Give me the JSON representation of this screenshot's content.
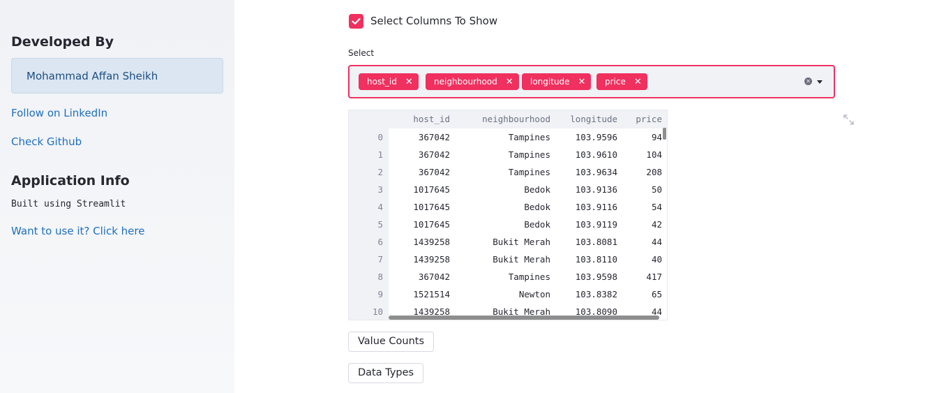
{
  "sidebar": {
    "developed_heading": "Developed By",
    "developer_name": "Mohammad Affan Sheikh",
    "linkedin_link": "Follow on LinkedIn",
    "github_link": "Check Github",
    "app_info_heading": "Application Info",
    "built_using": "Built using Streamlit",
    "use_link": "Want to use it? Click here"
  },
  "main": {
    "checkbox_label": "Select Columns To Show",
    "checkbox_checked": true,
    "select_label": "Select",
    "selected_chips": [
      "host_id",
      "neighbourhood",
      "longitude",
      "price"
    ],
    "buttons": {
      "value_counts": "Value Counts",
      "data_types": "Data Types"
    }
  },
  "table": {
    "columns": [
      "host_id",
      "neighbourhood",
      "longitude",
      "price"
    ],
    "rows": [
      {
        "index": "0",
        "host_id": "367042",
        "neighbourhood": "Tampines",
        "longitude": "103.9596",
        "price": "94"
      },
      {
        "index": "1",
        "host_id": "367042",
        "neighbourhood": "Tampines",
        "longitude": "103.9610",
        "price": "104"
      },
      {
        "index": "2",
        "host_id": "367042",
        "neighbourhood": "Tampines",
        "longitude": "103.9634",
        "price": "208"
      },
      {
        "index": "3",
        "host_id": "1017645",
        "neighbourhood": "Bedok",
        "longitude": "103.9136",
        "price": "50"
      },
      {
        "index": "4",
        "host_id": "1017645",
        "neighbourhood": "Bedok",
        "longitude": "103.9116",
        "price": "54"
      },
      {
        "index": "5",
        "host_id": "1017645",
        "neighbourhood": "Bedok",
        "longitude": "103.9119",
        "price": "42"
      },
      {
        "index": "6",
        "host_id": "1439258",
        "neighbourhood": "Bukit Merah",
        "longitude": "103.8081",
        "price": "44"
      },
      {
        "index": "7",
        "host_id": "1439258",
        "neighbourhood": "Bukit Merah",
        "longitude": "103.8110",
        "price": "40"
      },
      {
        "index": "8",
        "host_id": "367042",
        "neighbourhood": "Tampines",
        "longitude": "103.9598",
        "price": "417"
      },
      {
        "index": "9",
        "host_id": "1521514",
        "neighbourhood": "Newton",
        "longitude": "103.8382",
        "price": "65"
      },
      {
        "index": "10",
        "host_id": "1439258",
        "neighbourhood": "Bukit Merah",
        "longitude": "103.8090",
        "price": "44"
      }
    ]
  },
  "colors": {
    "accent": "#f0305f",
    "sidebar_bg": "#f0f2f6",
    "link": "#1f6fbf",
    "name_box_bg": "#dbe6f2"
  },
  "icons": {
    "checkbox": "check-icon",
    "chip_remove": "close-icon",
    "clear_all": "clear-icon",
    "dropdown": "chevron-down-icon",
    "fullscreen": "expand-icon"
  }
}
